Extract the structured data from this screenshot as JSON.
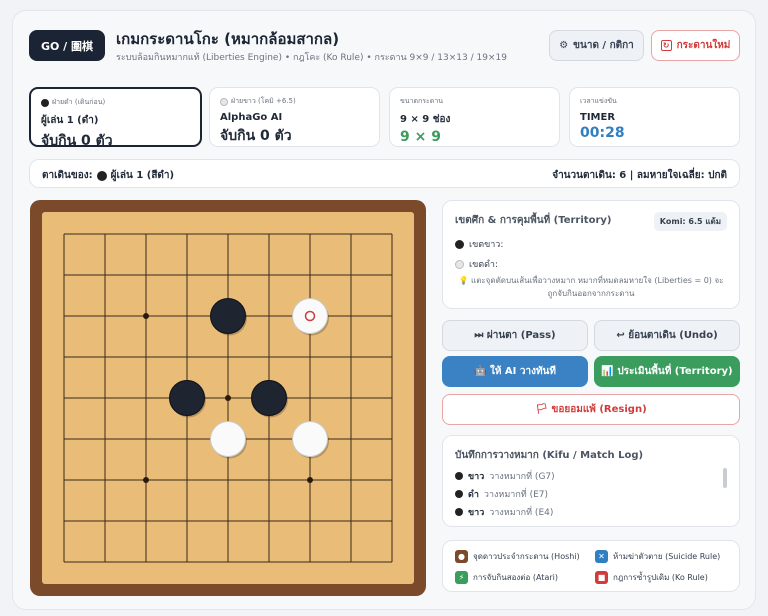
{
  "header": {
    "logo": "GO / 圍棋",
    "title": "เกมกระดานโกะ (หมากล้อมสากล)",
    "subtitle": "ระบบล้อมกินหมากแท้ (Liberties Engine) • กฎโคะ (Ko Rule) • กระดาน 9×9 / 13×13 / 19×19",
    "size_button": "ขนาด / กติกา",
    "size_icon": "gear-icon",
    "new_button": "กระดานใหม่",
    "new_icon": "refresh-icon"
  },
  "players": {
    "black": {
      "label": "ฝ่ายดำ (เดินก่อน)",
      "name": "ผู้เล่น 1 (ดำ)",
      "captures": "จับกิน 0 ตัว"
    },
    "white": {
      "label": "ฝ่ายขาว (โคมิ +6.5)",
      "name": "AlphaGo AI",
      "captures": "จับกิน 0 ตัว"
    },
    "board_size": {
      "label": "ขนาดกระดาน",
      "name": "9 × 9 ช่อง",
      "value": "9 × 9"
    },
    "timer": {
      "label": "เวลาแข่งขัน",
      "name": "TIMER",
      "value": "00:28"
    }
  },
  "turn": {
    "label": "ตาเดินของ:",
    "player": "ผู้เล่น 1 (สีดำ)",
    "stats": "จำนวนตาเดิน: 6 | ลมหายใจเฉลี่ย: ปกติ"
  },
  "board": {
    "size": 9,
    "hoshi": [
      [
        2,
        2
      ],
      [
        6,
        2
      ],
      [
        4,
        4
      ],
      [
        2,
        6
      ],
      [
        6,
        6
      ]
    ],
    "stones": [
      {
        "col": 4,
        "row": 2,
        "color": "black"
      },
      {
        "col": 6,
        "row": 2,
        "color": "white",
        "last": true
      },
      {
        "col": 3,
        "row": 4,
        "color": "black"
      },
      {
        "col": 5,
        "row": 4,
        "color": "black"
      },
      {
        "col": 4,
        "row": 5,
        "color": "white"
      },
      {
        "col": 6,
        "row": 5,
        "color": "white"
      }
    ],
    "colors": {
      "wood": "#e9bc78",
      "frame": "#7a4a2a",
      "line": "#3b2a1a",
      "last_move": "#d13b3b"
    }
  },
  "territory": {
    "title": "เขตศึก & การคุมพื้นที่ (Territory)",
    "komi": "Komi: 6.5 แต้ม",
    "white_zone": "เขตขาว:",
    "black_zone": "เขตดำ:",
    "hint": "💡 แตะจุดตัดบนเส้นเพื่อวางหมาก หมากที่หมดลมหายใจ (Liberties = 0) จะถูกจับกินออกจากกระดาน"
  },
  "actions": {
    "pass": "⏭ ผ่านตา (Pass)",
    "undo": "↩ ย้อนตาเดิน (Undo)",
    "ai": "🤖 ให้ AI วางทันที",
    "territory": "📊 ประเมินพื้นที่ (Territory)",
    "resign": "🏳 ขอยอมแพ้ (Resign)"
  },
  "log": {
    "title": "บันทึกการวางหมาก (Kifu / Match Log)",
    "entries": [
      {
        "player": "ขาว",
        "text": "วางหมากที่ (G7)"
      },
      {
        "player": "ดำ",
        "text": "วางหมากที่ (E7)"
      },
      {
        "player": "ขาว",
        "text": "วางหมากที่ (E4)"
      }
    ]
  },
  "legend": {
    "hoshi": "จุดดาวประจำกระดาน (Hoshi)",
    "suicide": "ห้ามฆ่าตัวตาย (Suicide Rule)",
    "atari": "การจับกินสองต่อ (Atari)",
    "ko": "กฎการซ้ำรูปเดิม (Ko Rule)",
    "colors": {
      "hoshi": "#7a4a2a",
      "suicide": "#2f7fc1",
      "atari": "#3a9d5d",
      "ko": "#d13b3b"
    }
  }
}
